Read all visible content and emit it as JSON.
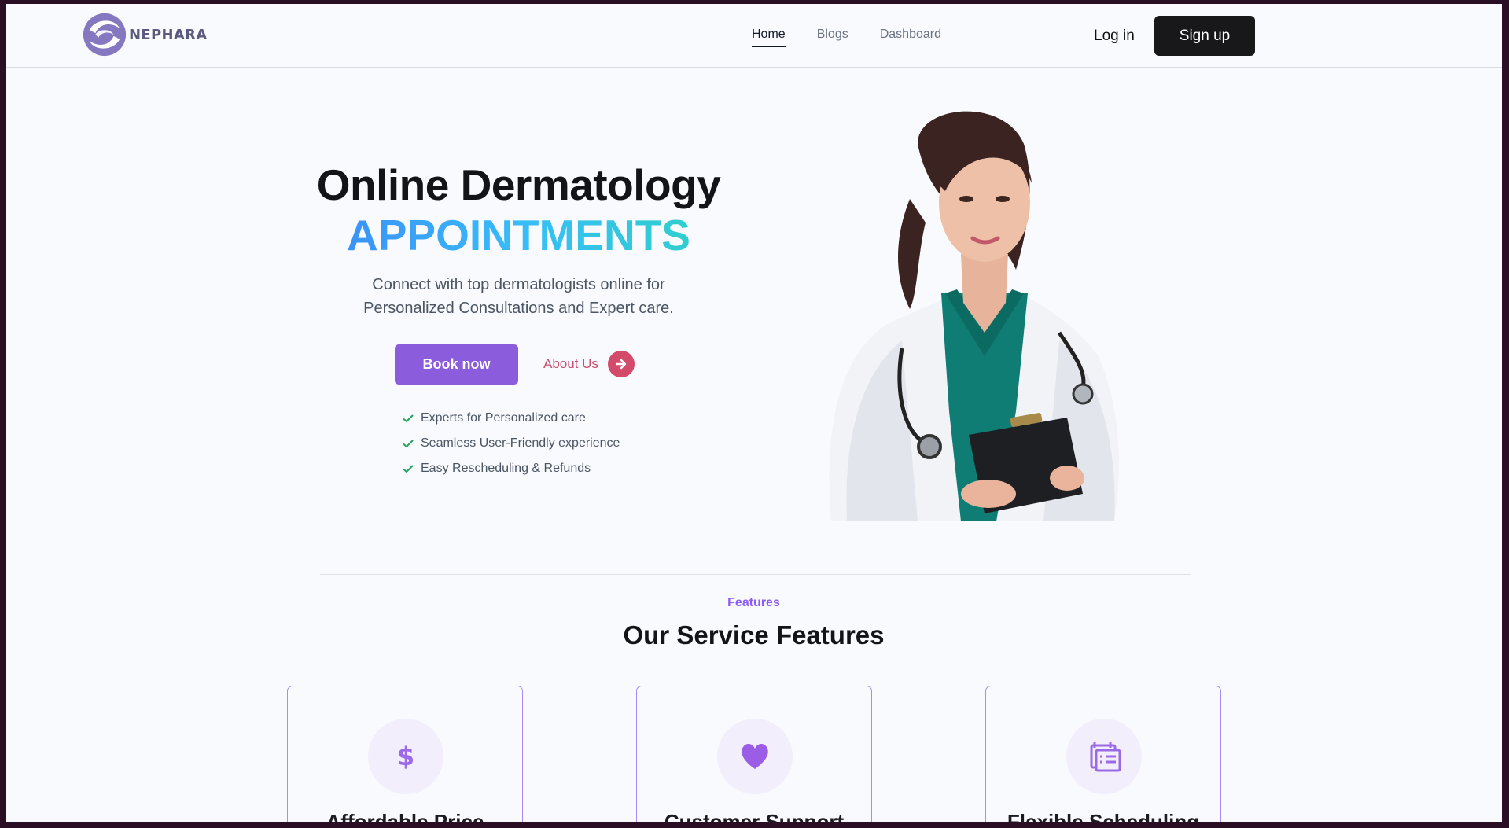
{
  "brand": {
    "name": "NEPHARA"
  },
  "nav": {
    "links": [
      {
        "label": "Home"
      },
      {
        "label": "Blogs"
      },
      {
        "label": "Dashboard"
      }
    ],
    "login_label": "Log in",
    "signup_label": "Sign up"
  },
  "hero": {
    "title": "Online Dermatology",
    "accent": "APPOINTMENTS",
    "subtitle_line1": "Connect with top dermatologists online for",
    "subtitle_line2": "Personalized Consultations and Expert care.",
    "book_label": "Book now",
    "about_label": "About Us",
    "checks": [
      "Experts for Personalized care",
      "Seamless User-Friendly experience",
      "Easy Rescheduling & Refunds"
    ]
  },
  "features": {
    "kicker": "Features",
    "title": "Our Service Features",
    "cards": [
      {
        "title": "Affordable Price",
        "icon": "dollar-icon"
      },
      {
        "title": "Customer Support",
        "icon": "heart-icon"
      },
      {
        "title": "Flexible Scheduling",
        "icon": "calendar-icon"
      }
    ]
  },
  "colors": {
    "accent_purple": "#8b5cdc",
    "about_pink": "#c9506f",
    "check_green": "#22a55a",
    "signup_dark": "#18181b"
  }
}
